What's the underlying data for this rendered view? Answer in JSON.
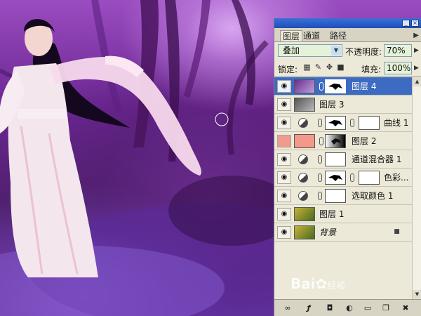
{
  "panel": {
    "tabs": [
      "图层",
      "通道",
      "路径"
    ],
    "active_tab": 0,
    "blend_mode": "叠加",
    "opacity_label": "不透明度:",
    "opacity_value": "70%",
    "lock_label": "锁定:",
    "fill_label": "填充:",
    "fill_value": "100%",
    "layers": [
      {
        "name": "图层 4",
        "selected": true
      },
      {
        "name": "图层 3"
      },
      {
        "name": "曲线 1"
      },
      {
        "name": "图层 2"
      },
      {
        "name": "通道混合器 1"
      },
      {
        "name": "色彩..."
      },
      {
        "name": "选取颜色 1"
      },
      {
        "name": "图层 1"
      },
      {
        "name": "背景"
      }
    ]
  },
  "watermark": {
    "brand": "Bai",
    "suffix": "经验"
  },
  "colors": {
    "selection": "#3d6bc2",
    "panel_bg": "#ece9d8",
    "photo_tint": "#6a2590"
  },
  "icons": [
    "eye-icon",
    "chain-icon",
    "adjustment-icon",
    "lock-icon",
    "link-layers-icon",
    "fx-icon",
    "mask-icon",
    "new-adjustment-icon",
    "group-icon",
    "new-layer-icon",
    "trash-icon"
  ]
}
